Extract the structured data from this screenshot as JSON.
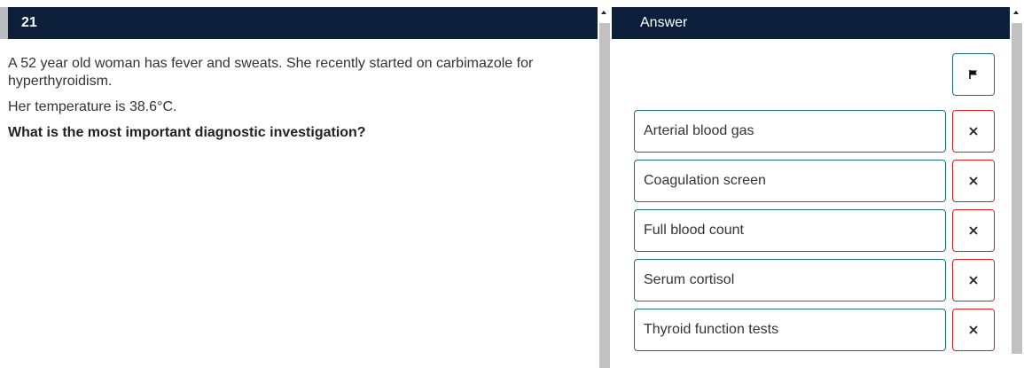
{
  "question": {
    "number": "21",
    "stem": "A 52 year old woman has fever and sweats. She recently started on carbimazole for hyperthyroidism.",
    "temperature": "Her temperature is 38.6°C.",
    "prompt": "What is the most important diagnostic investigation?"
  },
  "answer_panel": {
    "title": "Answer",
    "flag_icon": "flag-icon",
    "options": [
      {
        "label": "Arterial blood gas"
      },
      {
        "label": "Coagulation screen"
      },
      {
        "label": "Full blood count"
      },
      {
        "label": "Serum cortisol"
      },
      {
        "label": "Thyroid function tests"
      }
    ],
    "strike_icon": "close-icon"
  },
  "colors": {
    "header_bg": "#0b1f3a",
    "option_border": "#1f6f7a",
    "strike_border": "#c62828"
  }
}
